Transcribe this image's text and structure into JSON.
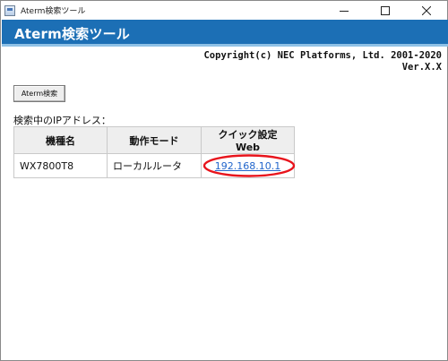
{
  "window": {
    "title": "Aterm検索ツール",
    "minimize_glyph": "minimize-icon",
    "maximize_glyph": "maximize-icon",
    "close_glyph": "close-icon"
  },
  "header": {
    "title": "Aterm検索ツール",
    "color": "#1c6fb5"
  },
  "about": {
    "copyright": "Copyright(c) NEC Platforms, Ltd. 2001-2020",
    "version": "Ver.X.X"
  },
  "toolbar": {
    "search_label": "Aterm検索"
  },
  "results": {
    "label": "検索中のIPアドレス：",
    "columns": [
      "機種名",
      "動作モード",
      "クイック設定Web"
    ],
    "rows": [
      {
        "model": "WX7800T8",
        "mode": "ローカルルータ",
        "web": "192.168.10.1"
      }
    ],
    "highlight_color": "#e8141c"
  }
}
